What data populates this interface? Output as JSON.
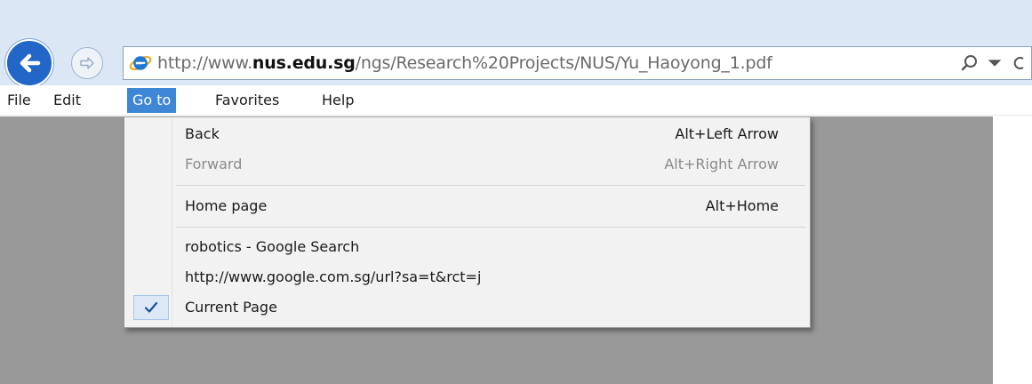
{
  "browser": {
    "address_bar": {
      "url_prefix": "http://www.",
      "url_domain": "nus.edu.sg",
      "url_path": "/ngs/Research%20Projects/NUS/Yu_Haoyong_1.pdf"
    },
    "icons": {
      "back": "back-arrow-icon",
      "forward": "forward-arrow-icon",
      "page": "internet-explorer-icon",
      "search": "search-icon",
      "dropdown": "chevron-down-icon"
    }
  },
  "menubar": {
    "items": [
      {
        "label": "File"
      },
      {
        "label": "Edit"
      },
      {
        "label": "Go to",
        "active": true
      },
      {
        "label": "Favorites"
      },
      {
        "label": "Help"
      }
    ]
  },
  "goto_menu": {
    "items": [
      {
        "label": "Back",
        "shortcut": "Alt+Left Arrow",
        "enabled": true
      },
      {
        "label": "Forward",
        "shortcut": "Alt+Right Arrow",
        "enabled": false
      },
      {
        "label": "Home page",
        "shortcut": "Alt+Home",
        "enabled": true
      },
      {
        "label": "robotics - Google Search",
        "shortcut": "",
        "enabled": true
      },
      {
        "label": "http://www.google.com.sg/url?sa=t&rct=j",
        "shortcut": "",
        "enabled": true
      },
      {
        "label": "Current Page",
        "shortcut": "",
        "enabled": true,
        "checked": true
      }
    ]
  },
  "colors": {
    "accent": "#3e86d6",
    "back_button": "#2266c7",
    "content_background": "#999999"
  }
}
